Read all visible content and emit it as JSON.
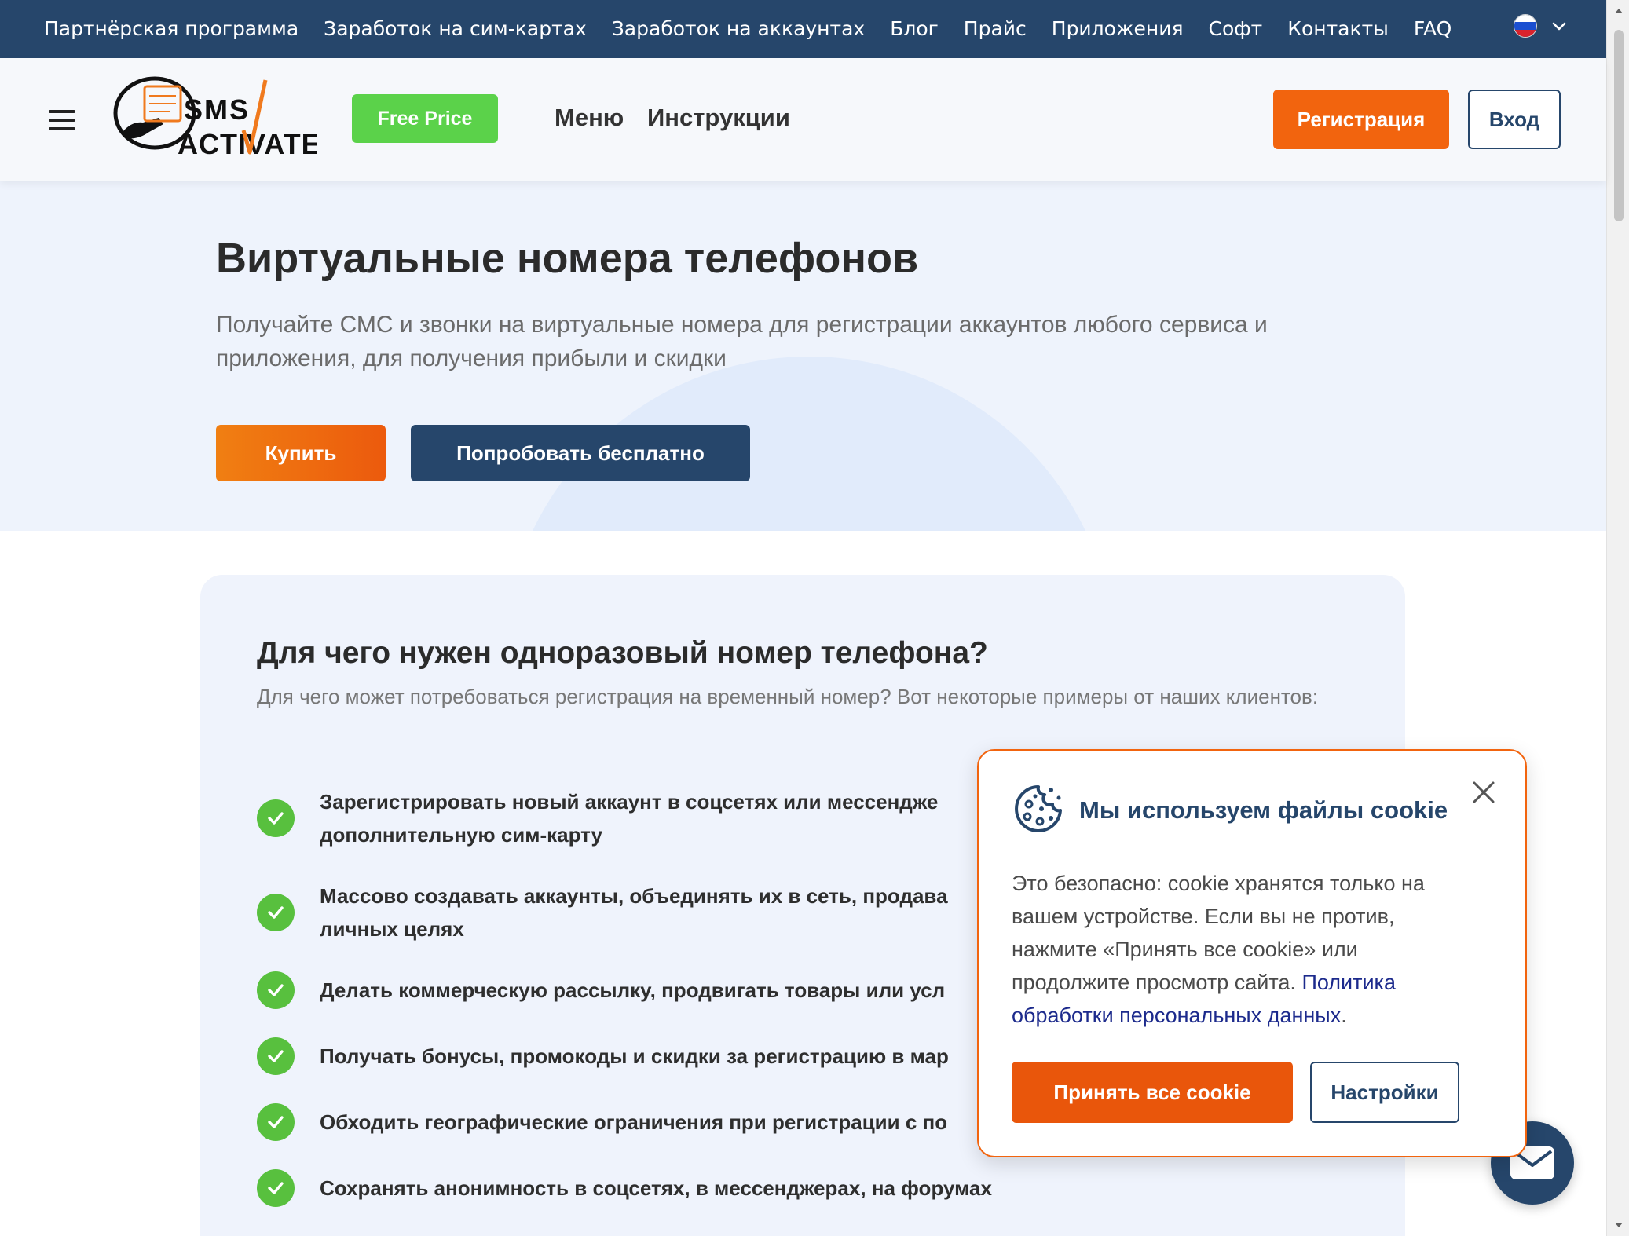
{
  "topnav": {
    "links": [
      "Партнёрская программа",
      "Заработок на сим-картах",
      "Заработок на аккаунтах",
      "Блог",
      "Прайс",
      "Приложения",
      "Софт",
      "Контакты",
      "FAQ"
    ],
    "language_flag": "russia-flag-icon",
    "colors": {
      "background": "#26466b",
      "text": "#ffffff"
    }
  },
  "header": {
    "logo_text_top": "SMS",
    "logo_text_bottom": "ACTIVATE",
    "free_price_label": "Free Price",
    "menu_label": "Меню",
    "instructions_label": "Инструкции",
    "register_label": "Регистрация",
    "login_label": "Вход",
    "colors": {
      "accent": "#f2640e",
      "free_price": "#5bd24a",
      "brand_dark": "#26466b"
    }
  },
  "hero": {
    "title": "Виртуальные номера телефонов",
    "subtitle": "Получайте СМС и звонки на виртуальные номера для регистрации аккаунтов любого сервиса и приложения, для получения прибыли и скидки",
    "buy_label": "Купить",
    "try_label": "Попробовать бесплатно"
  },
  "section": {
    "title": "Для чего нужен одноразовый номер телефона?",
    "subtitle": "Для чего может потребоваться регистрация на временный номер? Вот некоторые примеры от наших клиентов:",
    "reasons": [
      "Зарегистрировать новый аккаунт в соцсетях или мессендже",
      "дополнительную сим-карту",
      "Массово создавать аккаунты, объединять их в сеть, продава",
      "личных целях",
      "Делать коммерческую рассылку, продвигать товары или усл",
      "Получать бонусы, промокоды и скидки за регистрацию в мар",
      "Обходить географические ограничения при регистрации с по",
      "Сохранять анонимность в соцсетях, в мессенджерах, на форумах"
    ]
  },
  "cookie": {
    "icon": "cookie-icon",
    "title": "Мы используем файлы cookie",
    "body": "Это безопасно: cookie хранятся только на вашем устройстве. Если вы не против, нажмите «Принять все cookie» или продолжите просмотр сайта.",
    "policy_link": "Политика обработки персональных данных",
    "policy_suffix": ".",
    "accept_label": "Принять все cookie",
    "settings_label": "Настройки"
  },
  "chat": {
    "icon": "mail-icon"
  }
}
